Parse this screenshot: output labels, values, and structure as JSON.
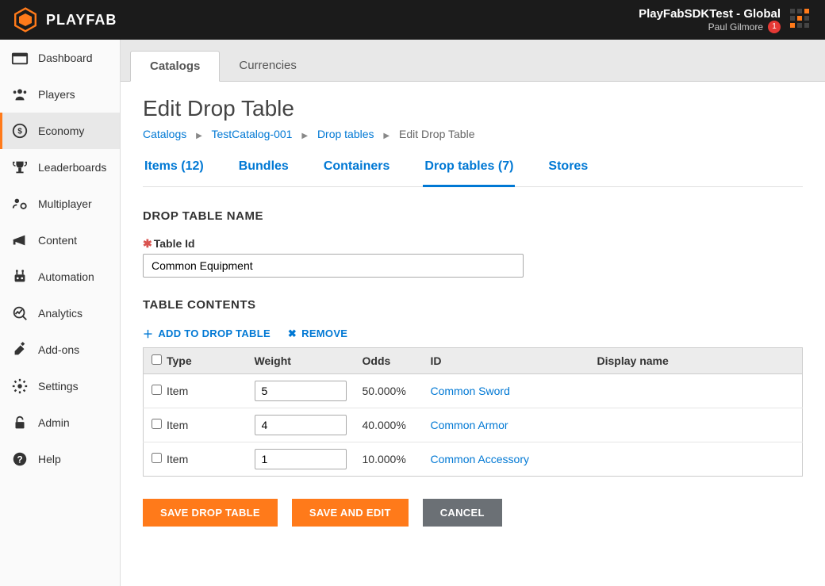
{
  "brand": {
    "name": "PLAYFAB"
  },
  "header": {
    "title": "PlayFabSDKTest - Global",
    "user": "Paul Gilmore",
    "notif_count": "1"
  },
  "sidebar": {
    "items": [
      {
        "label": "Dashboard"
      },
      {
        "label": "Players"
      },
      {
        "label": "Economy"
      },
      {
        "label": "Leaderboards"
      },
      {
        "label": "Multiplayer"
      },
      {
        "label": "Content"
      },
      {
        "label": "Automation"
      },
      {
        "label": "Analytics"
      },
      {
        "label": "Add-ons"
      },
      {
        "label": "Settings"
      },
      {
        "label": "Admin"
      },
      {
        "label": "Help"
      }
    ]
  },
  "top_tabs": {
    "catalogs": "Catalogs",
    "currencies": "Currencies"
  },
  "page": {
    "title": "Edit Drop Table"
  },
  "breadcrumb": {
    "catalogs": "Catalogs",
    "catalog_id": "TestCatalog-001",
    "drop_tables": "Drop tables",
    "current": "Edit Drop Table"
  },
  "subtabs": {
    "items": "Items (12)",
    "bundles": "Bundles",
    "containers": "Containers",
    "drop_tables": "Drop tables (7)",
    "stores": "Stores"
  },
  "form": {
    "section_name": "DROP TABLE NAME",
    "table_id_label": "Table Id",
    "table_id_value": "Common Equipment",
    "section_contents": "TABLE CONTENTS",
    "add_action": "ADD TO DROP TABLE",
    "remove_action": "REMOVE"
  },
  "table": {
    "headers": {
      "type": "Type",
      "weight": "Weight",
      "odds": "Odds",
      "id": "ID",
      "display": "Display name"
    },
    "rows": [
      {
        "type": "Item",
        "weight": "5",
        "odds": "50.000%",
        "id": "Common Sword",
        "display": ""
      },
      {
        "type": "Item",
        "weight": "4",
        "odds": "40.000%",
        "id": "Common Armor",
        "display": ""
      },
      {
        "type": "Item",
        "weight": "1",
        "odds": "10.000%",
        "id": "Common Accessory",
        "display": ""
      }
    ]
  },
  "buttons": {
    "save": "SAVE DROP TABLE",
    "save_edit": "SAVE AND EDIT",
    "cancel": "CANCEL"
  }
}
